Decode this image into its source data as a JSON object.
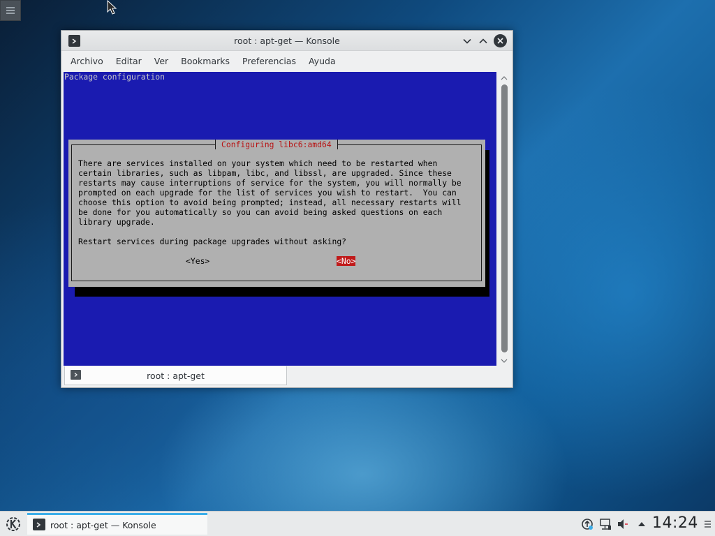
{
  "window": {
    "title": "root : apt-get — Konsole",
    "menu": [
      "Archivo",
      "Editar",
      "Ver",
      "Bookmarks",
      "Preferencias",
      "Ayuda"
    ]
  },
  "terminal": {
    "header": "Package configuration",
    "dialog": {
      "title": "Configuring libc6:amd64",
      "body": "There are services installed on your system which need to be restarted when\ncertain libraries, such as libpam, libc, and libssl, are upgraded. Since these\nrestarts may cause interruptions of service for the system, you will normally be\nprompted on each upgrade for the list of services you wish to restart.  You can\nchoose this option to avoid being prompted; instead, all necessary restarts will\nbe done for you automatically so you can avoid being asked questions on each\nlibrary upgrade.",
      "question": "Restart services during package upgrades without asking?",
      "yes_label": "<Yes>",
      "no_label": "<No>"
    }
  },
  "session_tab": {
    "label": "root : apt-get"
  },
  "taskbar": {
    "task_label": "root : apt-get — Konsole",
    "clock": "14:24"
  },
  "icons": {
    "terminal": "terminal-icon",
    "kde_menu": "kde-logo-icon",
    "tray": [
      "updates-icon",
      "network-icon",
      "volume-muted-icon",
      "expand-tray-icon"
    ]
  },
  "colors": {
    "terminal_bg": "#1a1bb0",
    "dialog_bg": "#b0b0b0",
    "dialog_title": "#b81414",
    "selected_button_bg": "#c01a1a",
    "accent": "#3daee9"
  }
}
